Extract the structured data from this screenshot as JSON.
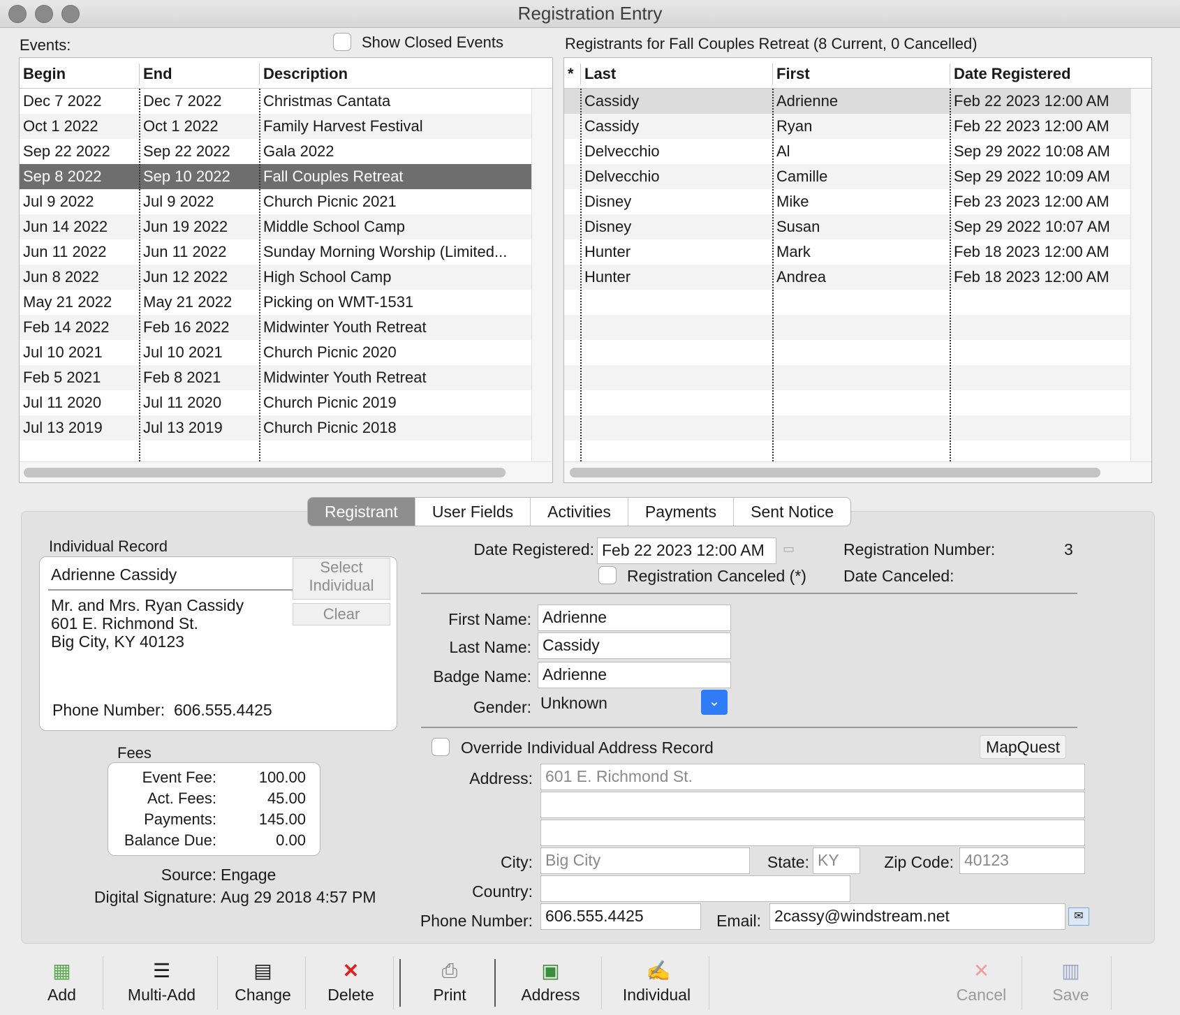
{
  "window": {
    "title": "Registration Entry"
  },
  "events": {
    "label": "Events:",
    "show_closed_label": "Show Closed Events",
    "columns": [
      "Begin",
      "End",
      "Description"
    ],
    "rows": [
      [
        "Dec 7 2022",
        "Dec 7 2022",
        "Christmas Cantata"
      ],
      [
        "Oct 1 2022",
        "Oct 1 2022",
        "Family Harvest Festival"
      ],
      [
        "Sep 22 2022",
        "Sep 22 2022",
        "Gala 2022"
      ],
      [
        "Sep 8 2022",
        "Sep 10 2022",
        "Fall Couples Retreat"
      ],
      [
        "Jul 9 2022",
        "Jul 9 2022",
        "Church Picnic 2021"
      ],
      [
        "Jun 14 2022",
        "Jun 19 2022",
        "Middle School Camp"
      ],
      [
        "Jun 11 2022",
        "Jun 11 2022",
        "Sunday Morning Worship (Limited..."
      ],
      [
        "Jun 8 2022",
        "Jun 12 2022",
        "High School Camp"
      ],
      [
        "May 21 2022",
        "May 21 2022",
        "Picking on WMT-1531"
      ],
      [
        "Feb 14 2022",
        "Feb 16 2022",
        "Midwinter Youth Retreat"
      ],
      [
        "Jul 10 2021",
        "Jul 10 2021",
        "Church Picnic 2020"
      ],
      [
        "Feb 5 2021",
        "Feb 8 2021",
        "Midwinter Youth Retreat"
      ],
      [
        "Jul 11 2020",
        "Jul 11 2020",
        "Church Picnic 2019"
      ],
      [
        "Jul 13 2019",
        "Jul 13 2019",
        "Church Picnic 2018"
      ]
    ],
    "selected_index": 3
  },
  "registrants": {
    "label": "Registrants for Fall Couples Retreat (8 Current, 0 Cancelled)",
    "columns": [
      "*",
      "Last",
      "First",
      "Date Registered"
    ],
    "rows": [
      [
        "Cassidy",
        "Adrienne",
        "Feb 22 2023 12:00 AM"
      ],
      [
        "Cassidy",
        "Ryan",
        "Feb 22 2023 12:00 AM"
      ],
      [
        "Delvecchio",
        "Al",
        "Sep 29 2022 10:08 AM"
      ],
      [
        "Delvecchio",
        "Camille",
        "Sep 29 2022 10:09 AM"
      ],
      [
        "Disney",
        "Mike",
        "Feb 23 2023 12:00 AM"
      ],
      [
        "Disney",
        "Susan",
        "Sep 29 2022 10:07 AM"
      ],
      [
        "Hunter",
        "Mark",
        "Feb 18 2023 12:00 AM"
      ],
      [
        "Hunter",
        "Andrea",
        "Feb 18 2023 12:00 AM"
      ]
    ],
    "selected_index": 0
  },
  "tabs": [
    "Registrant",
    "User Fields",
    "Activities",
    "Payments",
    "Sent Notice"
  ],
  "individual": {
    "section_label": "Individual Record",
    "name": "Adrienne Cassidy",
    "address_lines": [
      "Mr. and Mrs. Ryan Cassidy",
      "601 E. Richmond St.",
      "Big City, KY 40123"
    ],
    "phone_label": "Phone Number:",
    "phone": "606.555.4425",
    "select_btn_line1": "Select",
    "select_btn_line2": "Individual",
    "clear_btn": "Clear"
  },
  "fees": {
    "label": "Fees",
    "items": [
      {
        "label": "Event Fee:",
        "value": "100.00"
      },
      {
        "label": "Act. Fees:",
        "value": "45.00"
      },
      {
        "label": "Payments:",
        "value": "145.00"
      },
      {
        "label": "Balance Due:",
        "value": "0.00"
      }
    ]
  },
  "source": {
    "label": "Source:",
    "value": "Engage"
  },
  "signature": {
    "label": "Digital Signature:",
    "value": "Aug 29 2018 4:57 PM"
  },
  "form": {
    "date_registered_label": "Date Registered:",
    "date_registered": "Feb 22 2023 12:00 AM",
    "reg_number_label": "Registration Number:",
    "reg_number": "3",
    "canceled_check_label": "Registration Canceled (*)",
    "date_canceled_label": "Date Canceled:",
    "first_name_label": "First Name:",
    "first_name": "Adrienne",
    "last_name_label": "Last Name:",
    "last_name": "Cassidy",
    "badge_name_label": "Badge Name:",
    "badge_name": "Adrienne",
    "gender_label": "Gender:",
    "gender": "Unknown",
    "override_label": "Override Individual Address Record",
    "mapquest_btn": "MapQuest",
    "address_label": "Address:",
    "address1": "601 E. Richmond St.",
    "address2": "",
    "address3": "",
    "city_label": "City:",
    "city": "Big City",
    "state_label": "State:",
    "state": "KY",
    "zip_label": "Zip Code:",
    "zip": "40123",
    "country_label": "Country:",
    "country": "",
    "phone_label": "Phone Number:",
    "phone": "606.555.4425",
    "email_label": "Email:",
    "email": "2cassy@windstream.net"
  },
  "toolbar": {
    "add": "Add",
    "multi_add": "Multi-Add",
    "change": "Change",
    "delete": "Delete",
    "print": "Print",
    "address": "Address",
    "individual": "Individual",
    "cancel": "Cancel",
    "save": "Save"
  },
  "colors": {
    "selection": "#6e6e6e",
    "active_tab": "#8e8e8e",
    "delete_red": "#e02020",
    "dropdown_blue": "#2f7cf6"
  }
}
